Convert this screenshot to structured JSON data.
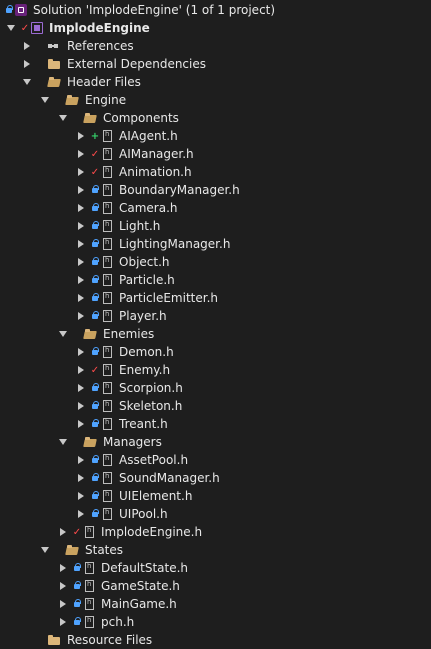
{
  "solution": {
    "label": "Solution 'ImplodeEngine' (1 of 1 project)"
  },
  "project": {
    "label": "ImplodeEngine"
  },
  "references": {
    "label": "References"
  },
  "external_dependencies": {
    "label": "External Dependencies"
  },
  "header_files": {
    "label": "Header Files"
  },
  "engine": {
    "label": "Engine"
  },
  "components": {
    "label": "Components",
    "files": [
      {
        "label": "AIAgent.h",
        "status": "added"
      },
      {
        "label": "AIManager.h",
        "status": "modified"
      },
      {
        "label": "Animation.h",
        "status": "modified"
      },
      {
        "label": "BoundaryManager.h",
        "status": "locked"
      },
      {
        "label": "Camera.h",
        "status": "locked"
      },
      {
        "label": "Light.h",
        "status": "locked"
      },
      {
        "label": "LightingManager.h",
        "status": "locked"
      },
      {
        "label": "Object.h",
        "status": "locked"
      },
      {
        "label": "Particle.h",
        "status": "locked"
      },
      {
        "label": "ParticleEmitter.h",
        "status": "locked"
      },
      {
        "label": "Player.h",
        "status": "locked"
      }
    ]
  },
  "enemies": {
    "label": "Enemies",
    "files": [
      {
        "label": "Demon.h",
        "status": "locked"
      },
      {
        "label": "Enemy.h",
        "status": "modified"
      },
      {
        "label": "Scorpion.h",
        "status": "locked"
      },
      {
        "label": "Skeleton.h",
        "status": "locked"
      },
      {
        "label": "Treant.h",
        "status": "locked"
      }
    ]
  },
  "managers": {
    "label": "Managers",
    "files": [
      {
        "label": "AssetPool.h",
        "status": "locked"
      },
      {
        "label": "SoundManager.h",
        "status": "locked"
      },
      {
        "label": "UIElement.h",
        "status": "locked"
      },
      {
        "label": "UIPool.h",
        "status": "locked"
      }
    ]
  },
  "implode_engine_h": {
    "label": "ImplodeEngine.h",
    "status": "modified"
  },
  "states": {
    "label": "States",
    "files": [
      {
        "label": "DefaultState.h",
        "status": "locked"
      },
      {
        "label": "GameState.h",
        "status": "locked"
      },
      {
        "label": "MainGame.h",
        "status": "locked"
      },
      {
        "label": "pch.h",
        "status": "locked"
      }
    ]
  },
  "resource_files": {
    "label": "Resource Files"
  },
  "colors": {
    "background": "#1e1e1e",
    "text": "#e8e8e8",
    "folder": "#dcb67a",
    "lock": "#4fa3ff",
    "modified": "#ff4b4b",
    "added": "#35d16a"
  }
}
